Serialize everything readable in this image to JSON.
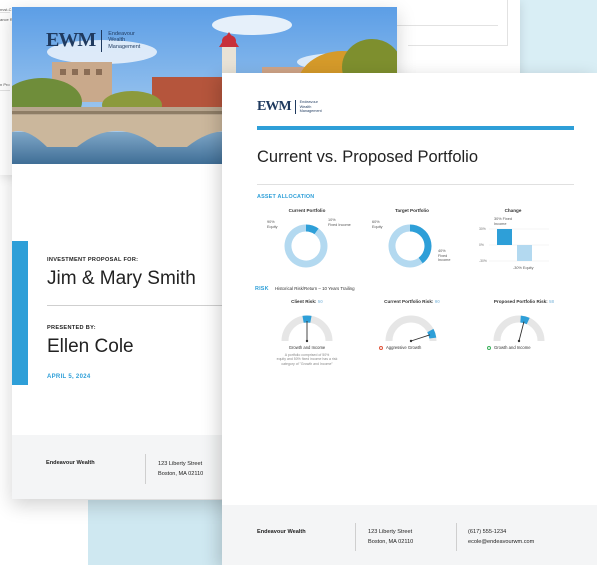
{
  "brand": {
    "mark": "EWM",
    "words": [
      "Endeavour",
      "Wealth",
      "Management"
    ],
    "navy": "#1f3a5f",
    "accent": "#2e9fd8"
  },
  "back_page": {
    "fragments": [
      "nvst-C",
      "ance R",
      "n Pro"
    ]
  },
  "cover": {
    "proposal_label": "INVESTMENT PROPOSAL FOR:",
    "client_name": "Jim & Mary Smith",
    "presented_label": "PRESENTED BY:",
    "advisor_name": "Ellen Cole",
    "date": "APRIL 5, 2024",
    "footer": {
      "company": "Endeavour Wealth",
      "address_line1": "123 Liberty Street",
      "address_line2": "Boston, MA 02110"
    }
  },
  "page2": {
    "title": "Current vs. Proposed Portfolio",
    "asset_allocation": {
      "heading": "ASSET ALLOCATION",
      "current": {
        "title": "Current Portfolio",
        "equity_label": [
          "90%",
          "Equity"
        ],
        "fixed_label": [
          "10%",
          "Fixed Income"
        ]
      },
      "target": {
        "title": "Target Portfolio",
        "equity_label": [
          "60%",
          "Equity"
        ],
        "fixed_label": [
          "40%",
          "Fixed",
          "Income"
        ]
      },
      "change": {
        "title": "Change",
        "pos_label": [
          "30% Fixed",
          "Income"
        ],
        "neg_label": "-30% Equity",
        "axis_ticks": [
          "30%",
          "0%",
          "-30%"
        ]
      }
    },
    "risk": {
      "heading": "RISK",
      "subheading": "Historical Risk/Return – 10 Years Trailing",
      "client": {
        "label": "Client Risk:",
        "value": "50",
        "category": "Growth and Income",
        "note": [
          "A portfolio comprised of 50%",
          "equity and 50% fixed income has a risk",
          "category of \"Growth and Income\""
        ]
      },
      "current": {
        "label": "Current Portfolio Risk:",
        "value": "90",
        "category": "Aggressive Growth",
        "status_icon_color": "#e0533a"
      },
      "proposed": {
        "label": "Proposed Portfolio Risk:",
        "value": "58",
        "category": "Growth and Income",
        "status_icon_color": "#3ab05a"
      }
    },
    "footer": {
      "company": "Endeavour Wealth",
      "address_line1": "123 Liberty Street",
      "address_line2": "Boston, MA 02110",
      "phone": "(617) 555-1234",
      "email": "ecole@endeavourwm.com"
    }
  },
  "chart_data": [
    {
      "type": "pie",
      "title": "Current Portfolio",
      "categories": [
        "Equity",
        "Fixed Income"
      ],
      "values": [
        90,
        10
      ]
    },
    {
      "type": "pie",
      "title": "Target Portfolio",
      "categories": [
        "Equity",
        "Fixed Income"
      ],
      "values": [
        60,
        40
      ]
    },
    {
      "type": "bar",
      "title": "Change",
      "categories": [
        "Fixed Income",
        "Equity"
      ],
      "values": [
        30,
        -30
      ],
      "ylim": [
        -30,
        30
      ],
      "ytick_labels": [
        "30%",
        "0%",
        "-30%"
      ]
    }
  ]
}
